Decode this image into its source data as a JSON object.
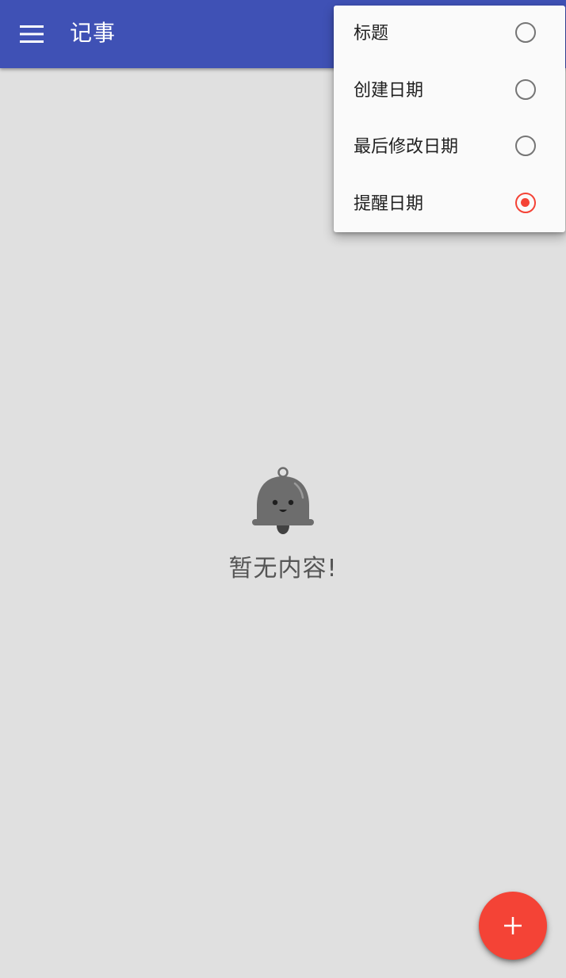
{
  "appbar": {
    "title": "记事",
    "color": "#3f51b5",
    "menu_icon": "hamburger-menu-icon"
  },
  "empty_state": {
    "icon": "bell-icon",
    "message": "暂无内容!"
  },
  "sort_menu": {
    "options": [
      {
        "label": "标题",
        "selected": false
      },
      {
        "label": "创建日期",
        "selected": false
      },
      {
        "label": "最后修改日期",
        "selected": false
      },
      {
        "label": "提醒日期",
        "selected": true
      }
    ],
    "accent_color": "#f44336"
  },
  "fab": {
    "icon": "plus-icon",
    "color": "#f44336"
  }
}
